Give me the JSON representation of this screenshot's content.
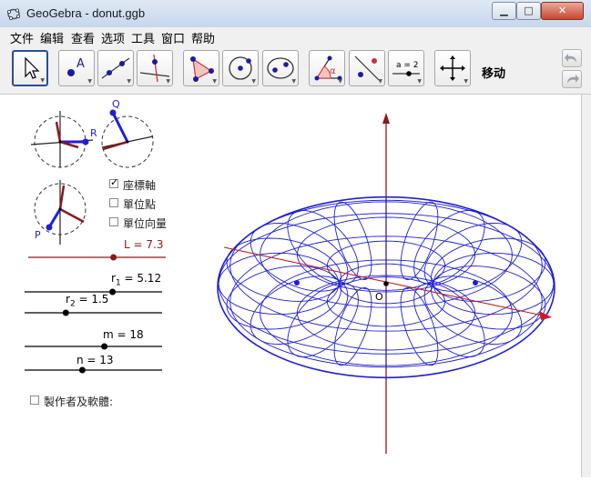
{
  "window": {
    "title": "GeoGebra - donut.ggb",
    "min_glyph": "▁",
    "max_glyph": "□",
    "close_glyph": "✕"
  },
  "menu": [
    "文件",
    "编辑",
    "查看",
    "选项",
    "工具",
    "窗口",
    "帮助"
  ],
  "toolbar": {
    "active_tool_label": "移动",
    "tools": [
      "move-tool-icon",
      "new-point-icon",
      "line-icon",
      "perpendicular-line-icon",
      "polygon-icon",
      "circle-icon",
      "conic-icon",
      "angle-icon",
      "reflect-icon",
      "slider-icon",
      "move-view-icon"
    ],
    "slider_tool_text": "a = 2",
    "point_tool_text": "A"
  },
  "side_panel": {
    "labels": {
      "q": "Q",
      "r": "R",
      "p": "P"
    },
    "checkboxes": [
      {
        "label": "座標軸",
        "checked": true
      },
      {
        "label": "單位點",
        "checked": false
      },
      {
        "label": "單位向量",
        "checked": false
      }
    ],
    "sliders": {
      "L": {
        "name": "L",
        "value": "7.3",
        "fraction": 0.62
      },
      "r1": {
        "name": "r",
        "sub": "1",
        "value": "5.12",
        "fraction": 0.64
      },
      "r2": {
        "name": "r",
        "sub": "2",
        "value": "1.5",
        "fraction": 0.3
      },
      "m": {
        "name": "m",
        "value": "18",
        "fraction": 0.58
      },
      "n": {
        "name": "n",
        "value": "13",
        "fraction": 0.42
      }
    },
    "author_checkbox": {
      "label": "製作者及軟體:",
      "checked": false
    }
  },
  "graphics": {
    "origin_label": "O",
    "colors": {
      "torus": "#1f1fd6",
      "x_axis": "#cc1b1b",
      "z_axis": "#8b1a1a",
      "slider_point": "#8b1a1a",
      "frame": "#2a4f8f"
    }
  }
}
